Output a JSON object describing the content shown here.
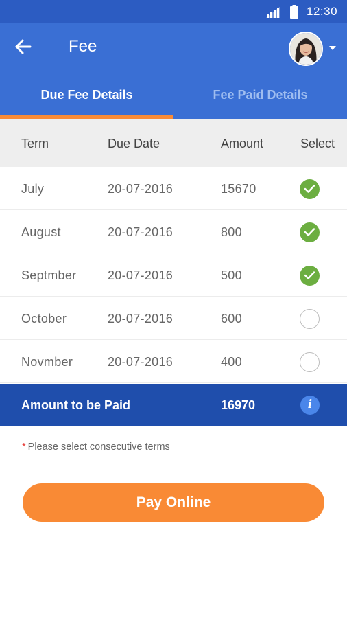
{
  "status_bar": {
    "time": "12:30",
    "signal_icon": "signal-icon",
    "battery_icon": "battery-icon"
  },
  "app_bar": {
    "title": "Fee",
    "back_icon": "arrow-left-icon",
    "avatar": "user-avatar",
    "menu_icon": "caret-down-icon"
  },
  "tabs": [
    {
      "label": "Due Fee Details",
      "active": true
    },
    {
      "label": "Fee Paid Details",
      "active": false
    }
  ],
  "table": {
    "headers": {
      "term": "Term",
      "due_date": "Due Date",
      "amount": "Amount",
      "select": "Select"
    },
    "rows": [
      {
        "term": "July",
        "due_date": "20-07-2016",
        "amount": "15670",
        "selected": true
      },
      {
        "term": "August",
        "due_date": "20-07-2016",
        "amount": "800",
        "selected": true
      },
      {
        "term": "Septmber",
        "due_date": "20-07-2016",
        "amount": "500",
        "selected": true
      },
      {
        "term": "October",
        "due_date": "20-07-2016",
        "amount": "600",
        "selected": false
      },
      {
        "term": "Novmber",
        "due_date": "20-07-2016",
        "amount": "400",
        "selected": false
      }
    ]
  },
  "total": {
    "label": "Amount to be Paid",
    "value": "16970",
    "info_icon": "info-icon"
  },
  "note": {
    "asterisk": "*",
    "text": "Please select consecutive terms"
  },
  "pay_button": {
    "label": "Pay Online"
  },
  "colors": {
    "status_bar": "#2c5cc2",
    "primary": "#3a6fd4",
    "total_bar": "#1f4eac",
    "accent_orange": "#f98a35",
    "check_green": "#6cae41",
    "tab_inactive": "#9fbdf0"
  }
}
